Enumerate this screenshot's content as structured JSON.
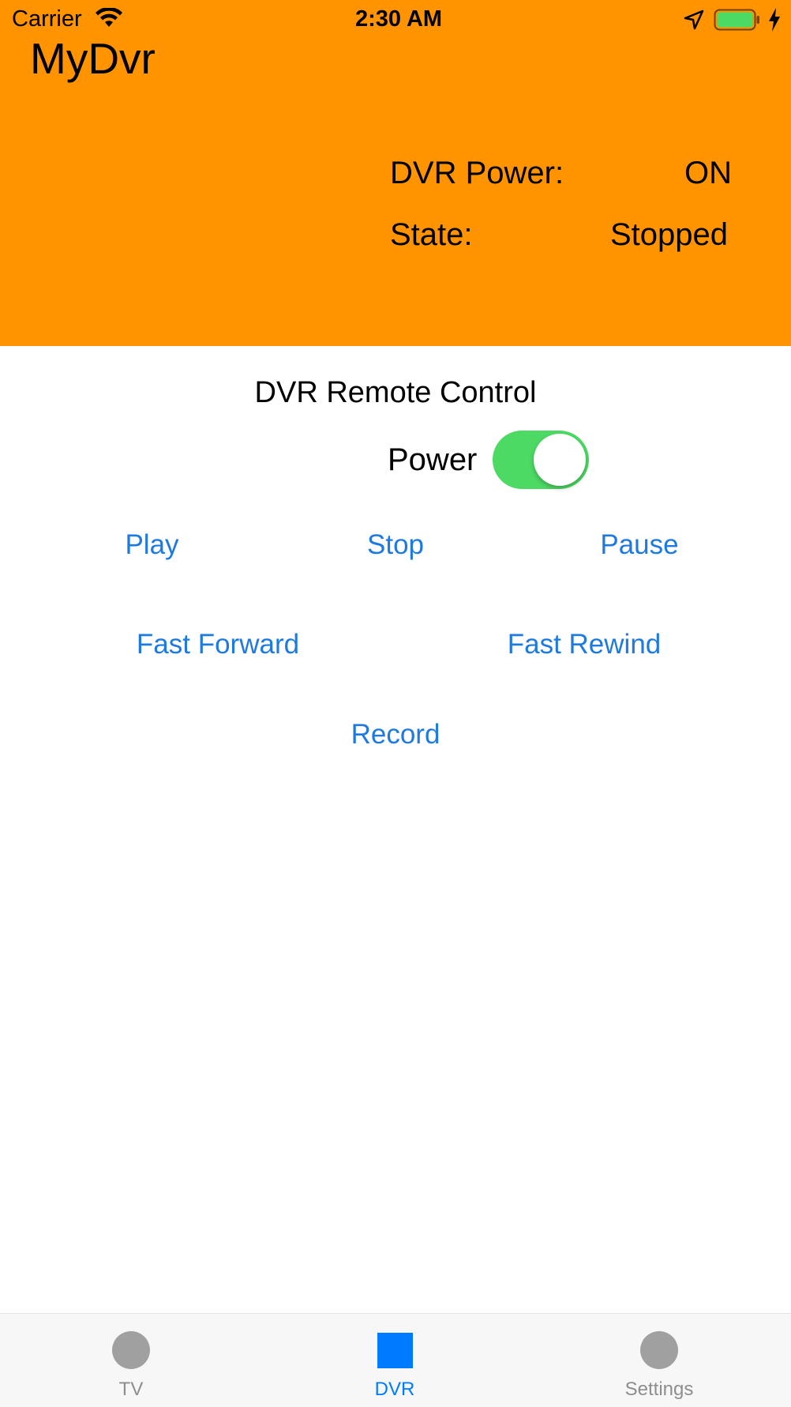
{
  "status_bar": {
    "carrier": "Carrier",
    "time": "2:30 AM",
    "icons": [
      "wifi-icon",
      "location-icon",
      "battery-icon",
      "charging-icon"
    ]
  },
  "header": {
    "title": "MyDvr",
    "dvr_power_label": "DVR Power:",
    "dvr_power_value": "ON",
    "state_label": "State:",
    "state_value": "Stopped"
  },
  "remote": {
    "title": "DVR Remote Control",
    "power_label": "Power",
    "power_on": true,
    "buttons": {
      "play": "Play",
      "stop": "Stop",
      "pause": "Pause",
      "fast_forward": "Fast Forward",
      "fast_rewind": "Fast Rewind",
      "record": "Record"
    }
  },
  "tabs": [
    {
      "label": "TV",
      "icon": "circle-icon",
      "active": false
    },
    {
      "label": "DVR",
      "icon": "square-icon",
      "active": true
    },
    {
      "label": "Settings",
      "icon": "circle-icon",
      "active": false
    }
  ],
  "colors": {
    "header_bg": "#FF9400",
    "toggle_on": "#4CD964",
    "button_text": "#1F7AE0",
    "tab_active": "#007AFF",
    "tab_inactive": "#8E8E8E"
  }
}
